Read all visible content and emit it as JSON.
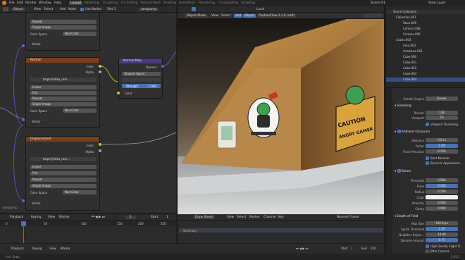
{
  "topbar": {
    "menus": [
      "File",
      "Edit",
      "Render",
      "Window",
      "Help"
    ],
    "workspaces": [
      "Layout",
      "Modeling",
      "Sculpting",
      "UV Editing",
      "Texture Paint",
      "Shading",
      "Animation",
      "Rendering",
      "Compositing",
      "Scripting"
    ],
    "scene": "Scene.01",
    "view_layer": "View Layer"
  },
  "node_header": {
    "mode": "Object",
    "menus": [
      "View",
      "Select",
      "Add",
      "Node"
    ],
    "use_nodes": "Use Nodes",
    "slot": "Slot 1",
    "material": "rampjump"
  },
  "node_editor": {
    "top_rows": [
      "Repeat",
      "Single Image",
      "Color Space",
      "Non-Color",
      "Vector"
    ],
    "normal_node": {
      "title": "Normal",
      "outputs": [
        "Color",
        "Alpha"
      ],
      "image": "trophyVideo_ram...",
      "rows": [
        "Linear",
        "Flat",
        "Repeat",
        "Single Image"
      ],
      "color_space_label": "Color Space",
      "color_space": "Non-Color",
      "input": "Vector"
    },
    "normal_map_node": {
      "title": "Normal Map",
      "output": "Normal",
      "space": "Tangent Space",
      "strength_label": "Strength",
      "strength": "1.000",
      "input": "Color"
    },
    "displacement_node": {
      "title": "Displacement",
      "outputs": [
        "Color",
        "Alpha"
      ],
      "image": "trophyVideo_ram...",
      "rows": [
        "Linear",
        "Flat",
        "Repeat",
        "Single Image"
      ],
      "color_space_label": "Color Space",
      "color_space": "Non-Color",
      "input": "Vector"
    },
    "material_label": "rampjump"
  },
  "viewport": {
    "header": {
      "mode": "Object Mode",
      "menus": [
        "View",
        "Select",
        "Add",
        "Object"
      ],
      "addon": "Photon/Flow 2.1.0 (soft)",
      "orientation": "Local"
    },
    "sign_lines": [
      "CAUTION",
      "ANGRY GAMER"
    ]
  },
  "timeline": {
    "menus": [
      "Playback",
      "Keying",
      "View",
      "Marker"
    ],
    "current_frame": "1",
    "start_label": "Start",
    "start": "1",
    "ruler": [
      "0",
      "50",
      "100",
      "150",
      "200",
      "250"
    ]
  },
  "dopesheet": {
    "mode": "Dope Sheet",
    "menus": [
      "View",
      "Select",
      "Marker",
      "Channel",
      "Key"
    ],
    "interp": "Nearest Frame",
    "summary": "Summary"
  },
  "bottom_timeline": {
    "menus": [
      "Playback",
      "Keying",
      "View",
      "Marker"
    ],
    "start_label": "Start",
    "start": "1",
    "end_label": "End",
    "end": "250"
  },
  "outliner": {
    "title": "Scene Collection",
    "items": [
      "Collection.007",
      "Stars.005",
      "Camera.008",
      "Camera.006",
      "Cubes.004",
      "Area.003",
      "Armature.001",
      "Cube.060",
      "Cube.061",
      "Cube.062",
      "Cube.063",
      "Cube.064"
    ]
  },
  "properties": {
    "render_engine_label": "Render Engine",
    "render_engine": "Eevee",
    "sampling": {
      "title": "Sampling",
      "render_label": "Render",
      "render": "128",
      "viewport_label": "Viewport",
      "viewport": "16",
      "denoise": "Viewport Denoising"
    },
    "ao": {
      "title": "Ambient Occlusion",
      "distance_label": "Distance",
      "distance": "0.2 m",
      "factor_label": "Factor",
      "factor": "1.00",
      "precision_label": "Trace Precision",
      "precision": "0.250",
      "bent_normals": "Bent Normals",
      "bounces": "Bounces Approximat..."
    },
    "bloom": {
      "title": "Bloom",
      "threshold_label": "Threshold",
      "threshold": "0.800",
      "knee_label": "Knee",
      "knee": "0.500",
      "radius_label": "Radius",
      "radius": "6.500",
      "color_label": "Color",
      "intensity_label": "Intensity",
      "intensity": "0.050",
      "clamp_label": "Clamp",
      "clamp": "0.000"
    },
    "dof": {
      "title": "Depth of Field",
      "max_size_label": "Max Size",
      "max_size": "100.0 px",
      "sprite_label": "Sprite Threshold",
      "sprite": "1.00",
      "neighbor_label": "Neighbor Reject...",
      "neighbor": "10.00",
      "denoise_label": "Denoise Amount",
      "denoise": "0.75",
      "hq": "High Quality Slight D...",
      "jitter": "Jitter Camera"
    }
  },
  "status": {
    "left": "Axis Snap",
    "version": "2.93.1"
  }
}
